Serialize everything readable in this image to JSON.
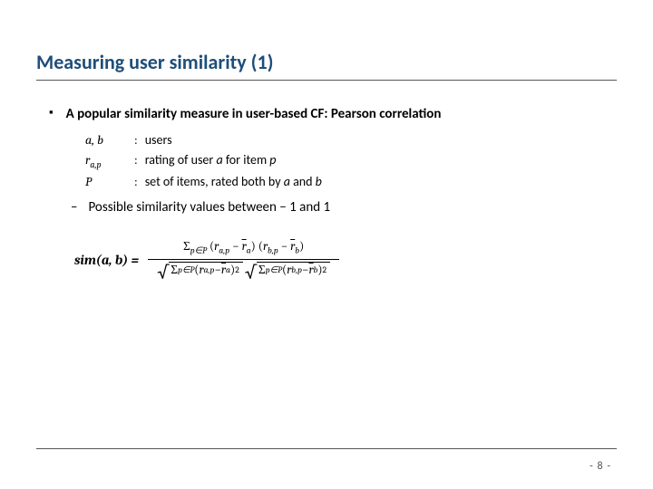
{
  "title": "Measuring user similarity (1)",
  "bullet": {
    "mark": "▪",
    "text": "A popular similarity measure in user-based CF: Pearson correlation"
  },
  "defs": {
    "ab_term": "a, b",
    "ab_desc": "users",
    "rap_term": "r",
    "rap_sub": "a,p",
    "rap_desc_prefix": "rating of user ",
    "rap_desc_mid": " for item ",
    "rap_user": "a",
    "rap_item": "p",
    "P_term": "P",
    "P_desc_prefix": "set of items, rated both by ",
    "P_a": "a",
    "P_and": " and ",
    "P_b": "b"
  },
  "sub_bullet": {
    "dash": "–",
    "text": "Possible similarity values between − 1 and 1"
  },
  "formula": {
    "label_sim": "sim",
    "label_paren": "(a, b) = ",
    "sum": "Σ",
    "sum_sub": "p∈P",
    "r": "r",
    "a_p": "a,p",
    "b_p": "b,p",
    "rbar_a": "r",
    "rbar_a_sub": "a",
    "rbar_b": "r",
    "rbar_b_sub": "b",
    "sq": "2"
  },
  "page": "- 8 -"
}
